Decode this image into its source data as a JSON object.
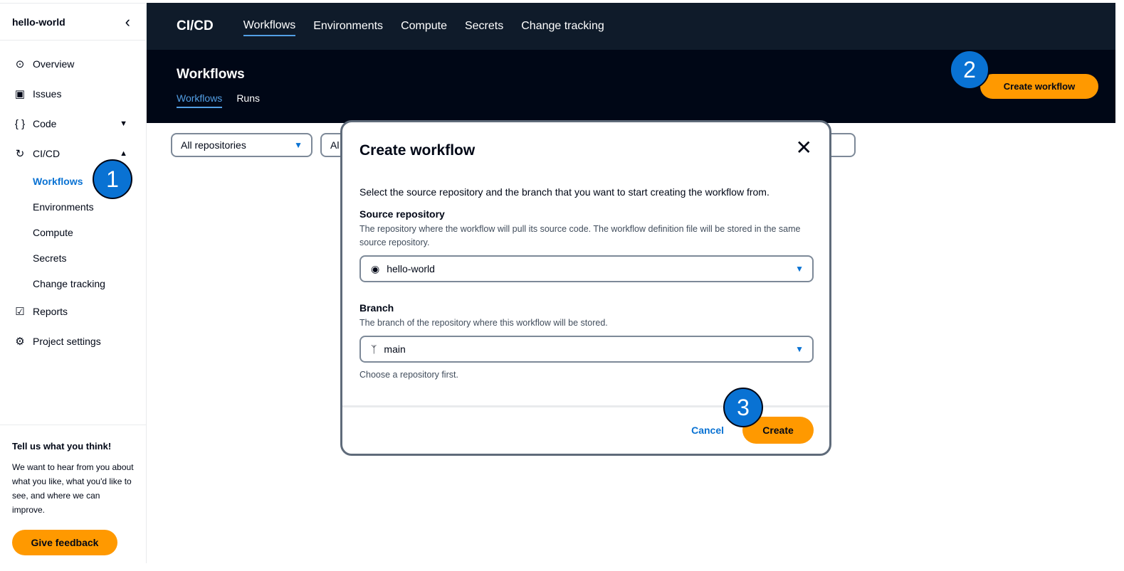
{
  "sidebar": {
    "title": "hello-world",
    "items": [
      {
        "label": "Overview"
      },
      {
        "label": "Issues"
      },
      {
        "label": "Code"
      },
      {
        "label": "CI/CD"
      }
    ],
    "sub": [
      "Workflows",
      "Environments",
      "Compute",
      "Secrets",
      "Change tracking"
    ],
    "bottom": [
      {
        "label": "Reports"
      },
      {
        "label": "Project settings"
      }
    ],
    "feedback": {
      "title": "Tell us what you think!",
      "text": "We want to hear from you about what you like, what you'd like to see, and where we can improve.",
      "button": "Give feedback"
    }
  },
  "topnav": {
    "brand": "CI/CD",
    "items": [
      "Workflows",
      "Environments",
      "Compute",
      "Secrets",
      "Change tracking"
    ]
  },
  "header": {
    "title": "Workflows",
    "tabs": [
      "Workflows",
      "Runs"
    ],
    "create": "Create workflow"
  },
  "filters": [
    "All repositories",
    "Al"
  ],
  "badges": [
    "1",
    "2",
    "3"
  ],
  "modal": {
    "title": "Create workflow",
    "description": "Select the source repository and the branch that you want to start creating the workflow from.",
    "source_label": "Source repository",
    "source_hint": "The repository where the workflow will pull its source code. The workflow definition file will be stored in the same source repository.",
    "source_value": "hello-world",
    "branch_label": "Branch",
    "branch_hint": "The branch of the repository where this workflow will be stored.",
    "branch_value": "main",
    "branch_note": "Choose a repository first.",
    "cancel": "Cancel",
    "create": "Create"
  }
}
